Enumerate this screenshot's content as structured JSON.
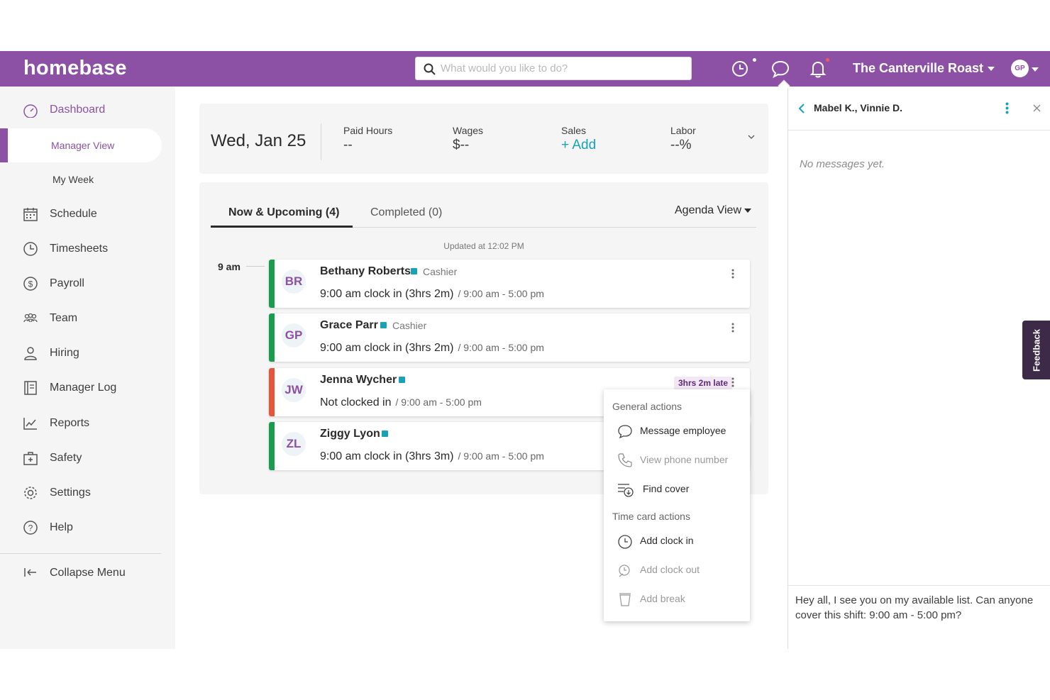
{
  "topbar": {
    "logo": "homebase",
    "search_placeholder": "What would you like to do?",
    "location": "The Canterville Roast",
    "user_initials": "GP",
    "colors": {
      "brand": "#8c51a5",
      "accent": "#17a2b8",
      "notification_dot": "#f15b50"
    }
  },
  "sidebar": {
    "items": [
      {
        "label": "Dashboard",
        "icon": "dashboard-icon"
      },
      {
        "label": "Schedule",
        "icon": "calendar-icon"
      },
      {
        "label": "Timesheets",
        "icon": "clock-icon"
      },
      {
        "label": "Payroll",
        "icon": "dollar-icon"
      },
      {
        "label": "Team",
        "icon": "team-icon"
      },
      {
        "label": "Hiring",
        "icon": "person-icon"
      },
      {
        "label": "Manager Log",
        "icon": "log-icon"
      },
      {
        "label": "Reports",
        "icon": "chart-icon"
      },
      {
        "label": "Safety",
        "icon": "first-aid-icon"
      },
      {
        "label": "Settings",
        "icon": "gear-icon"
      },
      {
        "label": "Help",
        "icon": "help-icon"
      }
    ],
    "sub_items": [
      "Manager View",
      "My Week"
    ],
    "collapse_label": "Collapse Menu"
  },
  "summary": {
    "date": "Wed, Jan 25",
    "stats": [
      {
        "label": "Paid Hours",
        "value": "--"
      },
      {
        "label": "Wages",
        "value": "$--"
      },
      {
        "label": "Sales",
        "value": "+ Add"
      },
      {
        "label": "Labor",
        "value": "--%"
      }
    ]
  },
  "panel": {
    "tabs": [
      "Now & Upcoming (4)",
      "Completed (0)"
    ],
    "view_select": "Agenda View",
    "updated": "Updated at 12:02 PM",
    "time_label": "9 am",
    "shifts": [
      {
        "initials": "BR",
        "name": "Bethany Roberts",
        "role": "Cashier",
        "status": "9:00 am clock in (3hrs 2m)",
        "shift": "/ 9:00 am - 5:00 pm",
        "color": "#1a9c4e"
      },
      {
        "initials": "GP",
        "name": "Grace Parr",
        "role": "Cashier",
        "status": "9:00 am clock in (3hrs 2m)",
        "shift": "/ 9:00 am - 5:00 pm",
        "color": "#1a9c4e"
      },
      {
        "initials": "JW",
        "name": "Jenna Wycher",
        "role": "",
        "status": "Not clocked in",
        "shift": "/ 9:00 am - 5:00 pm",
        "color": "#e8543a",
        "badge": "3hrs 2m late"
      },
      {
        "initials": "ZL",
        "name": "Ziggy Lyon",
        "role": "",
        "status": "9:00 am clock in (3hrs 3m)",
        "shift": "/ 9:00 am - 5:00 pm",
        "color": "#1a9c4e"
      }
    ]
  },
  "menu": {
    "general_header": "General actions",
    "general": [
      "Message employee",
      "View phone number",
      "Find cover"
    ],
    "timecard_header": "Time card actions",
    "timecard": [
      "Add clock in",
      "Add clock out",
      "Add break"
    ]
  },
  "chat": {
    "title": "Mabel K., Vinnie D.",
    "empty": "No messages yet.",
    "draft": "Hey all, I see you on my available list. Can anyone cover this shift: 9:00 am - 5:00 pm?"
  },
  "feedback_label": "Feedback"
}
